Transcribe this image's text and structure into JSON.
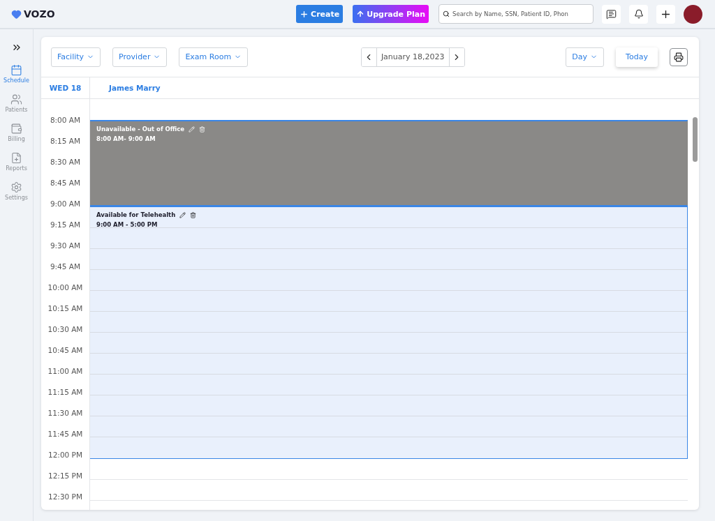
{
  "header": {
    "logo": "VOZO",
    "create_button": "Create",
    "upgrade_button": "Upgrade Plan",
    "search": {
      "placeholder": "Search by Name, SSN, Patient ID, Phon"
    }
  },
  "sidebar": {
    "items": [
      {
        "label": "Schedule",
        "selected": true
      },
      {
        "label": "Patients",
        "selected": false
      },
      {
        "label": "Billing",
        "selected": false
      },
      {
        "label": "Reports",
        "selected": false
      },
      {
        "label": "Settings",
        "selected": false
      }
    ]
  },
  "toolbar": {
    "filters": [
      "Facility",
      "Provider",
      "Exam Room"
    ],
    "date": "January 18,2023",
    "view": "Day",
    "today_button": "Today"
  },
  "calendar": {
    "day": "WED 18",
    "provider": "James Marry",
    "slots": [
      {
        "time": "8:00 AM",
        "kind": "unavailable"
      },
      {
        "time": "8:15 AM",
        "kind": "unavailable"
      },
      {
        "time": "8:30 AM",
        "kind": "unavailable"
      },
      {
        "time": "8:45 AM",
        "kind": "unavailable"
      },
      {
        "time": "9:00 AM",
        "kind": "available"
      },
      {
        "time": "9:15 AM",
        "kind": "available"
      },
      {
        "time": "9:30 AM",
        "kind": "available"
      },
      {
        "time": "9:45 AM",
        "kind": "available"
      },
      {
        "time": "10:00 AM",
        "kind": "available"
      },
      {
        "time": "10:15 AM",
        "kind": "available"
      },
      {
        "time": "10:30 AM",
        "kind": "available"
      },
      {
        "time": "10:45 AM",
        "kind": "available"
      },
      {
        "time": "11:00 AM",
        "kind": "available"
      },
      {
        "time": "11:15 AM",
        "kind": "available"
      },
      {
        "time": "11:30 AM",
        "kind": "available"
      },
      {
        "time": "11:45 AM",
        "kind": "available"
      },
      {
        "time": "12:00 PM",
        "kind": "open"
      },
      {
        "time": "12:15 PM",
        "kind": "open"
      },
      {
        "time": "12:30 PM",
        "kind": "open"
      }
    ],
    "events": [
      {
        "kind": "unavailable",
        "title": "Unavailable - Out of Office",
        "time": "8:00 AM- 9:00 AM"
      },
      {
        "kind": "available",
        "title": "Available for Telehealth",
        "time": "9:00 AM - 5:00 PM"
      }
    ]
  }
}
